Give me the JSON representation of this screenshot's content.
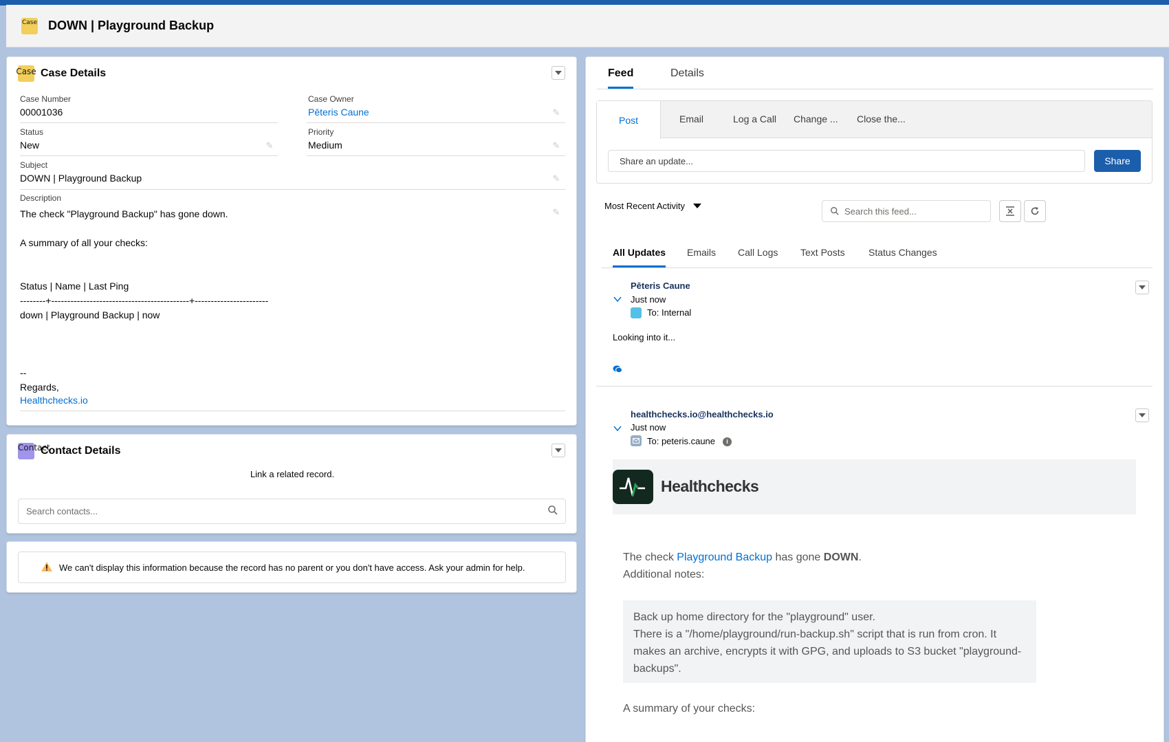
{
  "header": {
    "icon_label": "Case",
    "title": "DOWN | Playground Backup"
  },
  "case_details": {
    "icon_label": "Case",
    "title": "Case Details",
    "case_number_label": "Case Number",
    "case_number": "00001036",
    "case_owner_label": "Case Owner",
    "case_owner": "Pēteris Caune",
    "status_label": "Status",
    "status": "New",
    "priority_label": "Priority",
    "priority": "Medium",
    "subject_label": "Subject",
    "subject": "DOWN | Playground Backup",
    "description_label": "Description",
    "description": "The check \"Playground Backup\" has gone down.\n\nA summary of all your checks:\n\n\nStatus | Name | Last Ping\n--------+-------------------------------------------+-----------------------\ndown | Playground Backup | now\n\n\n\n--\nRegards,",
    "description_link": "Healthchecks.io"
  },
  "contact_details": {
    "icon_label": "Contact",
    "title": "Contact Details",
    "link_text": "Link a related record.",
    "search_placeholder": "Search contacts..."
  },
  "warning": {
    "text": "We can't display this information because the record has no parent or you don't have access. Ask your admin for help."
  },
  "feed": {
    "tabs": [
      "Feed",
      "Details"
    ],
    "publisher_tabs": [
      "Post",
      "Email",
      "Log a Call",
      "Change ...",
      "Close the..."
    ],
    "share_placeholder": "Share an update...",
    "share_button": "Share",
    "sort_label": "Most Recent Activity",
    "search_placeholder": "Search this feed...",
    "filter_tabs": [
      "All Updates",
      "Emails",
      "Call Logs",
      "Text Posts",
      "Status Changes"
    ],
    "post1": {
      "author": "Pēteris Caune",
      "time": "Just now",
      "to": "To: Internal",
      "body": "Looking into it..."
    },
    "post2": {
      "author": "healthchecks.io@healthchecks.io",
      "time": "Just now",
      "to": "To: peteris.caune",
      "brand": "Healthchecks",
      "line1_pre": "The check ",
      "line1_link": "Playground Backup",
      "line1_mid": " has gone ",
      "line1_status": "DOWN",
      "line1_end": ".",
      "notes_label": "Additional notes:",
      "notes_1": "Back up home directory for the \"playground\" user.",
      "notes_2": "There is a \"/home/playground/run-backup.sh\" script that is run from cron. It makes an archive, encrypts it with GPG, and uploads to S3 bucket \"playground-backups\".",
      "summary": "A summary of your checks:"
    }
  },
  "colors": {
    "brand": "#1b5eab",
    "link": "#0070d2",
    "case_icon": "#f2cf5b",
    "contact_icon": "#a094ed",
    "warning": "#ffb75d",
    "healthchecks_green": "#1fa35a"
  }
}
